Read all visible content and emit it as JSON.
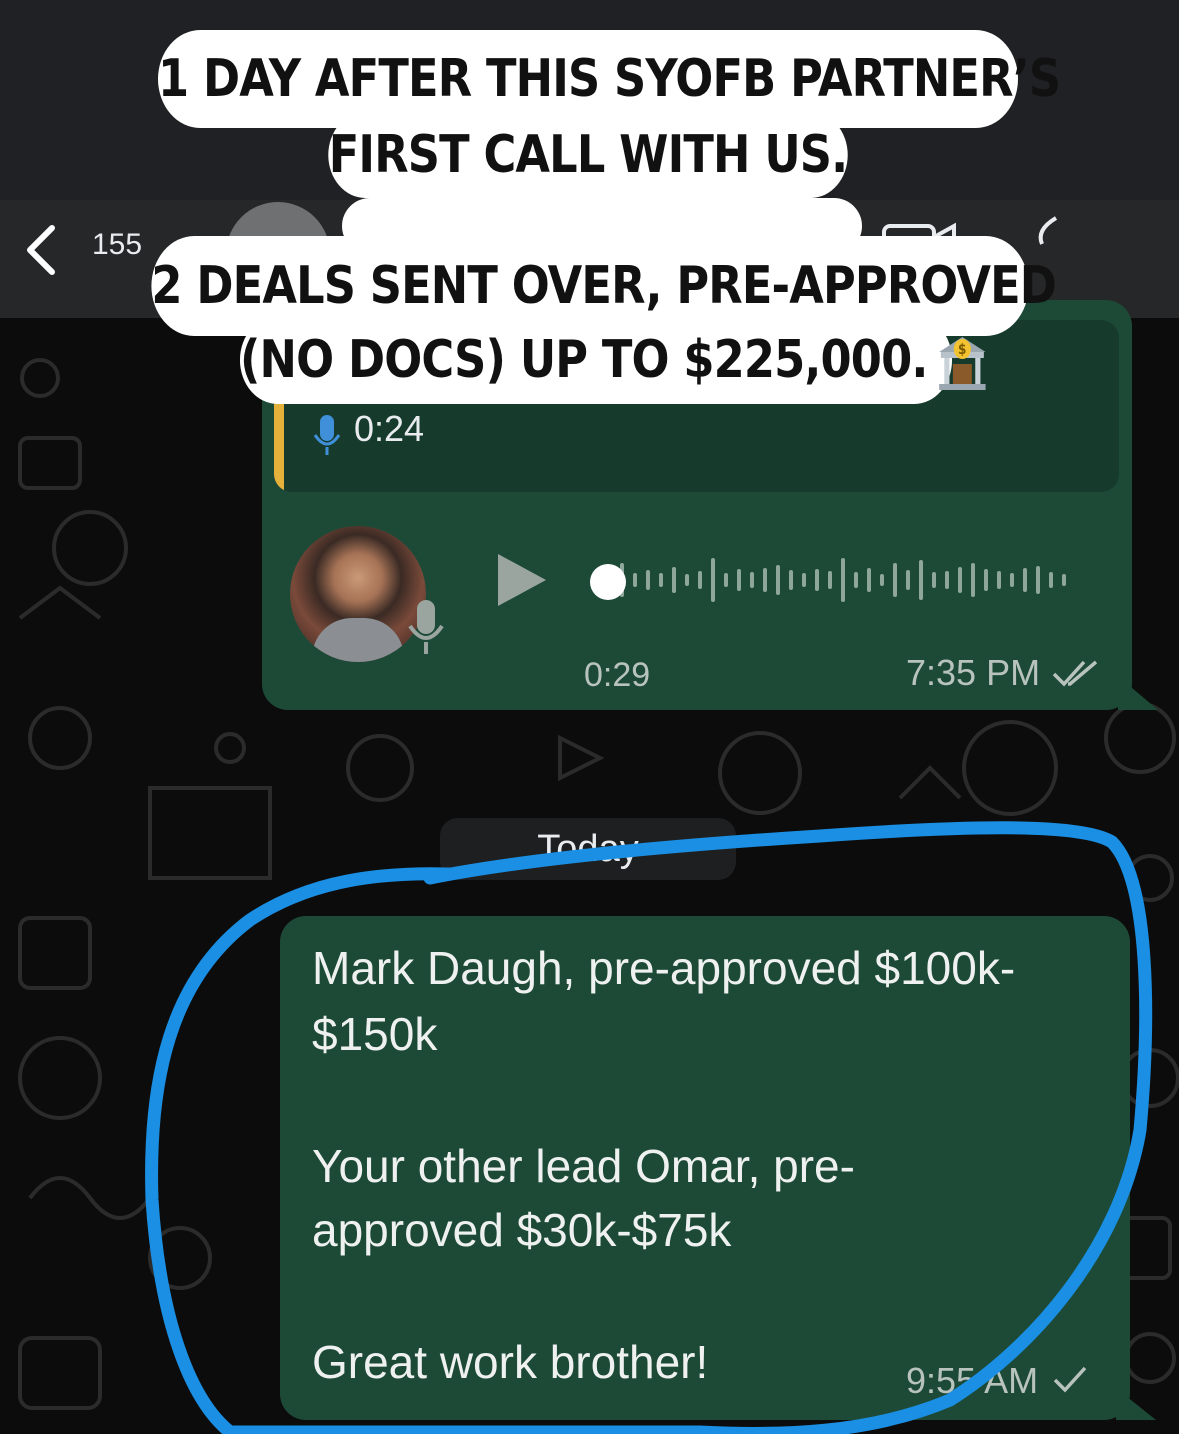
{
  "captions": {
    "line1": "1 DAY AFTER THIS SYOFB PARTNER’S",
    "line2": "FIRST CALL WITH US.",
    "line3": "2 DEALS SENT OVER, PRE-APPROVED",
    "line4": "(NO DOCS) UP TO $225,000."
  },
  "header": {
    "unread_count": "155"
  },
  "messages": {
    "voice_reply": {
      "quoted_duration": "0:24",
      "voice_duration": "0:29",
      "time": "7:35 PM",
      "status": "read"
    },
    "date_separator": "Today",
    "deals": {
      "line1": "Mark Daugh, pre-approved $100k-",
      "line2": "$150k",
      "line3": "Your other lead Omar, pre-",
      "line4": "approved $30k-$75k",
      "line5": "Great work brother!",
      "time": "9:55 AM",
      "status": "sent"
    }
  },
  "colors": {
    "bubble_outgoing": "#1d4a37",
    "highlight_circle": "#1a8fe3",
    "quote_bar": "#e4b23a"
  },
  "icons": [
    "back-chevron-icon",
    "video-call-icon",
    "phone-call-icon",
    "mic-icon",
    "play-icon",
    "double-check-icon",
    "single-check-icon",
    "bank-emoji-icon"
  ]
}
